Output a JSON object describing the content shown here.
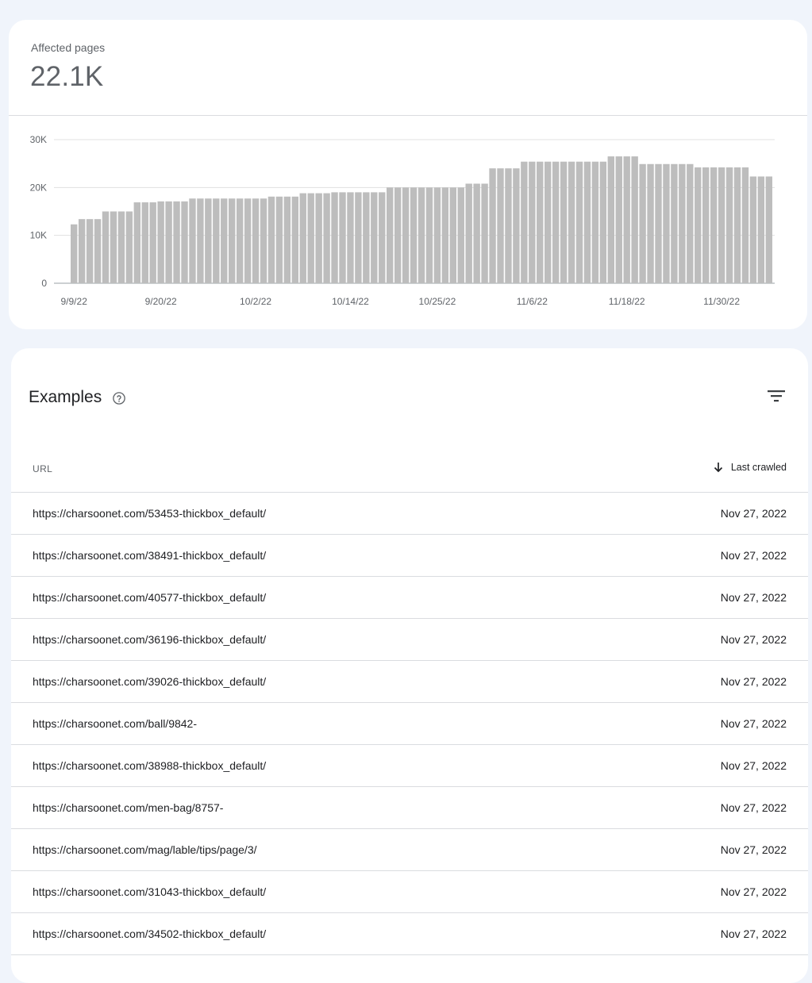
{
  "summary": {
    "label": "Affected pages",
    "value": "22.1K"
  },
  "chart_data": {
    "type": "bar",
    "y_ticks": [
      "30K",
      "20K",
      "10K",
      "0"
    ],
    "ylim": [
      0,
      30000
    ],
    "x_tick_labels": [
      "9/9/22",
      "9/20/22",
      "10/2/22",
      "10/14/22",
      "10/25/22",
      "11/6/22",
      "11/18/22",
      "11/30/22"
    ],
    "x_tick_indices": [
      0,
      11,
      23,
      35,
      46,
      58,
      70,
      82
    ],
    "values": [
      12300,
      13400,
      13400,
      13400,
      15000,
      15000,
      15000,
      15000,
      16900,
      16900,
      16900,
      17100,
      17100,
      17100,
      17100,
      17700,
      17700,
      17700,
      17700,
      17700,
      17700,
      17700,
      17700,
      17700,
      17700,
      18100,
      18100,
      18100,
      18100,
      18800,
      18800,
      18800,
      18800,
      19000,
      19000,
      19000,
      19000,
      19000,
      19000,
      19000,
      20000,
      20000,
      20000,
      20000,
      20000,
      20000,
      20000,
      20000,
      20000,
      20000,
      20800,
      20800,
      20800,
      24000,
      24000,
      24000,
      24000,
      25400,
      25400,
      25400,
      25400,
      25400,
      25400,
      25400,
      25400,
      25400,
      25400,
      25400,
      26500,
      26500,
      26500,
      26500,
      24900,
      24900,
      24900,
      24900,
      24900,
      24900,
      24900,
      24200,
      24200,
      24200,
      24200,
      24200,
      24200,
      24200,
      22300,
      22300,
      22300
    ],
    "bar_color": "#bdbdbd"
  },
  "examples": {
    "title": "Examples",
    "columns": {
      "url": "URL",
      "last_crawled": "Last crawled"
    },
    "rows": [
      {
        "url": "https://charsoonet.com/53453-thickbox_default/",
        "date": "Nov 27, 2022"
      },
      {
        "url": "https://charsoonet.com/38491-thickbox_default/",
        "date": "Nov 27, 2022"
      },
      {
        "url": "https://charsoonet.com/40577-thickbox_default/",
        "date": "Nov 27, 2022"
      },
      {
        "url": "https://charsoonet.com/36196-thickbox_default/",
        "date": "Nov 27, 2022"
      },
      {
        "url": "https://charsoonet.com/39026-thickbox_default/",
        "date": "Nov 27, 2022"
      },
      {
        "url": "https://charsoonet.com/ball/9842-",
        "date": "Nov 27, 2022"
      },
      {
        "url": "https://charsoonet.com/38988-thickbox_default/",
        "date": "Nov 27, 2022"
      },
      {
        "url": "https://charsoonet.com/men-bag/8757-",
        "date": "Nov 27, 2022"
      },
      {
        "url": "https://charsoonet.com/mag/lable/tips/page/3/",
        "date": "Nov 27, 2022"
      },
      {
        "url": "https://charsoonet.com/31043-thickbox_default/",
        "date": "Nov 27, 2022"
      },
      {
        "url": "https://charsoonet.com/34502-thickbox_default/",
        "date": "Nov 27, 2022"
      }
    ]
  },
  "icons": {
    "help": "help-circle-icon",
    "filter": "filter-icon",
    "sort": "arrow-down-icon"
  }
}
